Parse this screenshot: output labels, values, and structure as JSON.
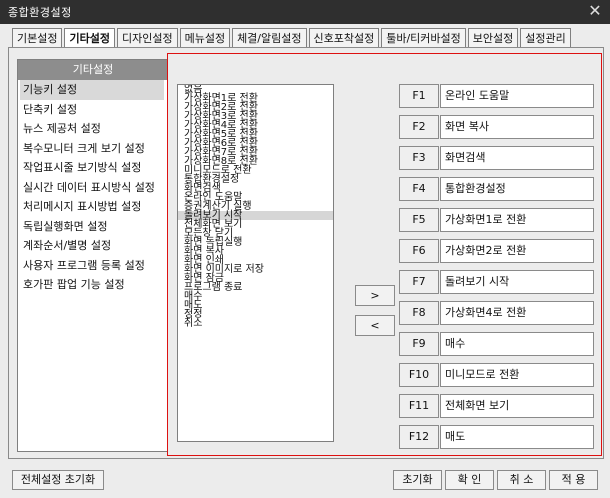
{
  "window": {
    "title": "종합환경설정",
    "close_glyph": "✕"
  },
  "tabs": [
    {
      "label": "기본설정"
    },
    {
      "label": "기타설정"
    },
    {
      "label": "디자인설정"
    },
    {
      "label": "메뉴설정"
    },
    {
      "label": "체결/알림설정"
    },
    {
      "label": "신호포착설정"
    },
    {
      "label": "툴바/티커바설정"
    },
    {
      "label": "보안설정"
    },
    {
      "label": "설정관리"
    }
  ],
  "sidebar": {
    "header": "기타설정",
    "items": [
      {
        "label": "기능키 설정"
      },
      {
        "label": "단축키 설정"
      },
      {
        "label": "뉴스 제공처 설정"
      },
      {
        "label": "복수모니터 크게 보기 설정"
      },
      {
        "label": "작업표시줄 보기방식 설정"
      },
      {
        "label": "실시간 데이터 표시방식 설정"
      },
      {
        "label": "처리메시지 표시방법 설정"
      },
      {
        "label": "독립실행화면 설정"
      },
      {
        "label": "계좌순서/별명 설정"
      },
      {
        "label": "사용자 프로그램 등록 설정"
      },
      {
        "label": "호가판 팝업 기능 설정"
      }
    ]
  },
  "function_list": [
    "없음",
    "가상화면1로 전환",
    "가상화면2로 전환",
    "가상화면3로 전환",
    "가상화면4로 전환",
    "가상화면5로 전환",
    "가상화면6로 전환",
    "가상화면7로 전환",
    "가상화면8로 전환",
    "미니모드로 전환",
    "통합환경설정",
    "화면검색",
    "온라인 도움말",
    "증권계산기 실행",
    "돌려보기 시작",
    "전체화면 보기",
    "모든창 닫기",
    "화면 독립실행",
    "화면 복사",
    "화면 인쇄",
    "화면 이미지로 저장",
    "화면 잠금",
    "프로그램 종료",
    "매수",
    "매도",
    "정정",
    "취소"
  ],
  "arrows": {
    "add": ">",
    "remove": "<"
  },
  "function_keys": [
    {
      "key": "F1",
      "value": "온라인 도움말"
    },
    {
      "key": "F2",
      "value": "화면 복사"
    },
    {
      "key": "F3",
      "value": "화면검색"
    },
    {
      "key": "F4",
      "value": "통합환경설정"
    },
    {
      "key": "F5",
      "value": "가상화면1로 전환"
    },
    {
      "key": "F6",
      "value": "가상화면2로 전환"
    },
    {
      "key": "F7",
      "value": "돌려보기 시작"
    },
    {
      "key": "F8",
      "value": "가상화면4로 전환"
    },
    {
      "key": "F9",
      "value": "매수"
    },
    {
      "key": "F10",
      "value": "미니모드로 전환"
    },
    {
      "key": "F11",
      "value": "전체화면 보기"
    },
    {
      "key": "F12",
      "value": "매도"
    }
  ],
  "footer": {
    "reset_all": "전체설정 초기화",
    "reset": "초기화",
    "ok": "확 인",
    "cancel": "취 소",
    "apply": "적 용"
  },
  "colors": {
    "accent_border": "#dd1111",
    "titlebar": "#2f2f2f"
  }
}
